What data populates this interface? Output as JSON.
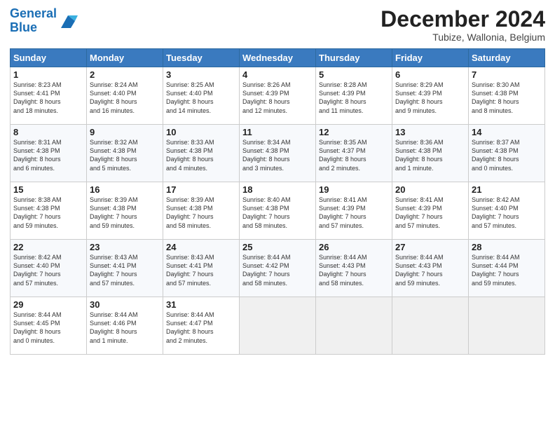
{
  "header": {
    "logo_line1": "General",
    "logo_line2": "Blue",
    "month": "December 2024",
    "location": "Tubize, Wallonia, Belgium"
  },
  "days_of_week": [
    "Sunday",
    "Monday",
    "Tuesday",
    "Wednesday",
    "Thursday",
    "Friday",
    "Saturday"
  ],
  "weeks": [
    [
      {
        "day": "1",
        "info": "Sunrise: 8:23 AM\nSunset: 4:41 PM\nDaylight: 8 hours\nand 18 minutes."
      },
      {
        "day": "2",
        "info": "Sunrise: 8:24 AM\nSunset: 4:40 PM\nDaylight: 8 hours\nand 16 minutes."
      },
      {
        "day": "3",
        "info": "Sunrise: 8:25 AM\nSunset: 4:40 PM\nDaylight: 8 hours\nand 14 minutes."
      },
      {
        "day": "4",
        "info": "Sunrise: 8:26 AM\nSunset: 4:39 PM\nDaylight: 8 hours\nand 12 minutes."
      },
      {
        "day": "5",
        "info": "Sunrise: 8:28 AM\nSunset: 4:39 PM\nDaylight: 8 hours\nand 11 minutes."
      },
      {
        "day": "6",
        "info": "Sunrise: 8:29 AM\nSunset: 4:39 PM\nDaylight: 8 hours\nand 9 minutes."
      },
      {
        "day": "7",
        "info": "Sunrise: 8:30 AM\nSunset: 4:38 PM\nDaylight: 8 hours\nand 8 minutes."
      }
    ],
    [
      {
        "day": "8",
        "info": "Sunrise: 8:31 AM\nSunset: 4:38 PM\nDaylight: 8 hours\nand 6 minutes."
      },
      {
        "day": "9",
        "info": "Sunrise: 8:32 AM\nSunset: 4:38 PM\nDaylight: 8 hours\nand 5 minutes."
      },
      {
        "day": "10",
        "info": "Sunrise: 8:33 AM\nSunset: 4:38 PM\nDaylight: 8 hours\nand 4 minutes."
      },
      {
        "day": "11",
        "info": "Sunrise: 8:34 AM\nSunset: 4:38 PM\nDaylight: 8 hours\nand 3 minutes."
      },
      {
        "day": "12",
        "info": "Sunrise: 8:35 AM\nSunset: 4:37 PM\nDaylight: 8 hours\nand 2 minutes."
      },
      {
        "day": "13",
        "info": "Sunrise: 8:36 AM\nSunset: 4:38 PM\nDaylight: 8 hours\nand 1 minute."
      },
      {
        "day": "14",
        "info": "Sunrise: 8:37 AM\nSunset: 4:38 PM\nDaylight: 8 hours\nand 0 minutes."
      }
    ],
    [
      {
        "day": "15",
        "info": "Sunrise: 8:38 AM\nSunset: 4:38 PM\nDaylight: 7 hours\nand 59 minutes."
      },
      {
        "day": "16",
        "info": "Sunrise: 8:39 AM\nSunset: 4:38 PM\nDaylight: 7 hours\nand 59 minutes."
      },
      {
        "day": "17",
        "info": "Sunrise: 8:39 AM\nSunset: 4:38 PM\nDaylight: 7 hours\nand 58 minutes."
      },
      {
        "day": "18",
        "info": "Sunrise: 8:40 AM\nSunset: 4:38 PM\nDaylight: 7 hours\nand 58 minutes."
      },
      {
        "day": "19",
        "info": "Sunrise: 8:41 AM\nSunset: 4:39 PM\nDaylight: 7 hours\nand 57 minutes."
      },
      {
        "day": "20",
        "info": "Sunrise: 8:41 AM\nSunset: 4:39 PM\nDaylight: 7 hours\nand 57 minutes."
      },
      {
        "day": "21",
        "info": "Sunrise: 8:42 AM\nSunset: 4:40 PM\nDaylight: 7 hours\nand 57 minutes."
      }
    ],
    [
      {
        "day": "22",
        "info": "Sunrise: 8:42 AM\nSunset: 4:40 PM\nDaylight: 7 hours\nand 57 minutes."
      },
      {
        "day": "23",
        "info": "Sunrise: 8:43 AM\nSunset: 4:41 PM\nDaylight: 7 hours\nand 57 minutes."
      },
      {
        "day": "24",
        "info": "Sunrise: 8:43 AM\nSunset: 4:41 PM\nDaylight: 7 hours\nand 57 minutes."
      },
      {
        "day": "25",
        "info": "Sunrise: 8:44 AM\nSunset: 4:42 PM\nDaylight: 7 hours\nand 58 minutes."
      },
      {
        "day": "26",
        "info": "Sunrise: 8:44 AM\nSunset: 4:43 PM\nDaylight: 7 hours\nand 58 minutes."
      },
      {
        "day": "27",
        "info": "Sunrise: 8:44 AM\nSunset: 4:43 PM\nDaylight: 7 hours\nand 59 minutes."
      },
      {
        "day": "28",
        "info": "Sunrise: 8:44 AM\nSunset: 4:44 PM\nDaylight: 7 hours\nand 59 minutes."
      }
    ],
    [
      {
        "day": "29",
        "info": "Sunrise: 8:44 AM\nSunset: 4:45 PM\nDaylight: 8 hours\nand 0 minutes."
      },
      {
        "day": "30",
        "info": "Sunrise: 8:44 AM\nSunset: 4:46 PM\nDaylight: 8 hours\nand 1 minute."
      },
      {
        "day": "31",
        "info": "Sunrise: 8:44 AM\nSunset: 4:47 PM\nDaylight: 8 hours\nand 2 minutes."
      },
      null,
      null,
      null,
      null
    ]
  ]
}
